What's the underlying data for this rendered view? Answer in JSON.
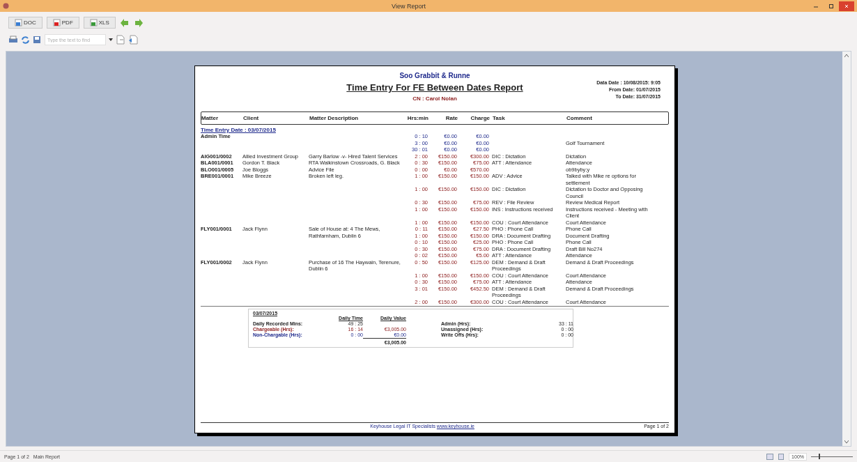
{
  "window": {
    "title": "View Report"
  },
  "export_buttons": [
    {
      "label": "DOC",
      "kind": "doc"
    },
    {
      "label": "PDF",
      "kind": "pdf"
    },
    {
      "label": "XLS",
      "kind": "xls"
    }
  ],
  "search": {
    "placeholder": "Type the text to find"
  },
  "report": {
    "firm": "Soo Grabbit & Runne",
    "title": "Time Entry For FE Between Dates Report",
    "fee_earner": "CN : Carol Nolan",
    "dates": [
      "Data Date : 10/08/2015: 9:05",
      "From Date: 01/07/2015",
      "To Date: 31/07/2015"
    ],
    "columns": [
      "Matter",
      "Client",
      "Matter Description",
      "Hrs:min",
      "Rate",
      "Charge",
      "Task",
      "Comment"
    ],
    "date_heading": "Time Entry Date : 03/07/2015",
    "matters": [
      {
        "matter": "Admin Time",
        "kind": "admin",
        "lines": [
          {
            "hrs": "0 : 10",
            "rate": "€0.00",
            "charge": "€0.00"
          },
          {
            "hrs": "3 : 00",
            "rate": "€0.00",
            "charge": "€0.00",
            "comment": "Golf Tournament"
          },
          {
            "hrs": "30 : 01",
            "rate": "€0.00",
            "charge": "€0.00"
          }
        ]
      },
      {
        "matter": "AIG001/0002",
        "client": "Allied Investment Group",
        "description": "Garry Barlow -v- Hired Talent Services",
        "kind": "chargeable",
        "lines": [
          {
            "hrs": "2 : 00",
            "rate": "€150.00",
            "charge": "€300.00",
            "task": "DIC :  Dictation",
            "comment": "Dictation"
          }
        ]
      },
      {
        "matter": "BLA001/0001",
        "client": "Gordon T. Black",
        "description": "RTA Walkinstown Crossroads, G. Black",
        "kind": "chargeable",
        "lines": [
          {
            "hrs": "0 : 30",
            "rate": "€150.00",
            "charge": "€75.00",
            "task": "ATT :  Attendance",
            "comment": "Attendance"
          }
        ]
      },
      {
        "matter": "BLO001/0005",
        "client": "Joe Bloggs",
        "description": "Advice File",
        "kind": "chargeable",
        "lines": [
          {
            "hrs": "0 : 00",
            "rate": "€0.00",
            "charge": "€570.00",
            "comment": "ob9byby;y"
          }
        ]
      },
      {
        "matter": "BRE001/0001",
        "client": "Mike Breeze",
        "description": "Broken left leg.",
        "kind": "chargeable",
        "lines": [
          {
            "hrs": "1 : 00",
            "rate": "€150.00",
            "charge": "€150.00",
            "task": "ADV :  Advice",
            "comment": "Talked with Mike re options for settlement"
          },
          {
            "hrs": "1 : 00",
            "rate": "€150.00",
            "charge": "€150.00",
            "task": "DIC :  Dictation",
            "comment": "Dictation to Doctor and Opposing Council"
          },
          {
            "hrs": "0 : 30",
            "rate": "€150.00",
            "charge": "€75.00",
            "task": "REV :  File Review",
            "comment": "Review Medical Report"
          },
          {
            "hrs": "1 : 00",
            "rate": "€150.00",
            "charge": "€150.00",
            "task": "INS :  Instructions received",
            "comment": "Instructions received - Meeting with Client"
          },
          {
            "hrs": "1 : 00",
            "rate": "€150.00",
            "charge": "€150.00",
            "task": "COU :  Court Attendance",
            "comment": "Court Attendance"
          }
        ]
      },
      {
        "matter": "FLY001/0001",
        "client": "Jack Flynn",
        "description": "Sale of House at:  4 The Mews, Rathfarnham, Dublin 6",
        "kind": "chargeable",
        "lines": [
          {
            "hrs": "0 : 11",
            "rate": "€150.00",
            "charge": "€27.50",
            "task": "PHO :  Phone Call",
            "comment": "Phone Call"
          },
          {
            "hrs": "1 : 00",
            "rate": "€150.00",
            "charge": "€150.00",
            "task": "DRA :  Document Drafting",
            "comment": "Document Drafting"
          },
          {
            "hrs": "0 : 10",
            "rate": "€150.00",
            "charge": "€25.00",
            "task": "PHO :  Phone Call",
            "comment": "Phone Call"
          },
          {
            "hrs": "0 : 30",
            "rate": "€150.00",
            "charge": "€75.00",
            "task": "DRA :  Document Drafting",
            "comment": "Draft Bill No274"
          },
          {
            "hrs": "0 : 02",
            "rate": "€150.00",
            "charge": "€5.00",
            "task": "ATT :  Attendance",
            "comment": "Attendance"
          }
        ]
      },
      {
        "matter": "FLY001/0002",
        "client": "Jack Flynn",
        "description": "Purchase of 16 The Haywain, Terenure, Dublin 6",
        "kind": "chargeable",
        "lines": [
          {
            "hrs": "0 : 50",
            "rate": "€150.00",
            "charge": "€125.00",
            "task": "DEM :  Demand & Draft Proceedings",
            "comment": "Demand & Draft Proceedings"
          },
          {
            "hrs": "1 : 00",
            "rate": "€150.00",
            "charge": "€150.00",
            "task": "COU :  Court Attendance",
            "comment": "Court Attendance"
          },
          {
            "hrs": "0 : 30",
            "rate": "€150.00",
            "charge": "€75.00",
            "task": "ATT :  Attendance",
            "comment": "Attendance"
          },
          {
            "hrs": "3 : 01",
            "rate": "€150.00",
            "charge": "€452.50",
            "task": "DEM :  Demand & Draft Proceedings",
            "comment": "Demand & Draft Proceedings"
          },
          {
            "hrs": "2 : 00",
            "rate": "€150.00",
            "charge": "€300.00",
            "task": "COU :  Court Attendance",
            "comment": "Court Attendance"
          }
        ]
      }
    ],
    "summary": {
      "date": "03/07/2015",
      "time_heading": "Daily Time",
      "value_heading": "Daily Value",
      "rows": [
        {
          "label": "Daily Recorded Mins:",
          "time": "49 : 25",
          "kind": "total"
        },
        {
          "label": "Chargeable (Hrs):",
          "time": "16 : 14",
          "value": "€3,005.00",
          "kind": "chargeable"
        },
        {
          "label": "Non-Chargable (Hrs):",
          "time": "0 : 00",
          "value": "€0.00",
          "kind": "admin"
        }
      ],
      "grand_total": "€3,005.00",
      "side": [
        {
          "label": "Admin (Hrs):",
          "value": "33 : 11"
        },
        {
          "label": "Unassigned  (Hrs):",
          "value": "0 : 00"
        },
        {
          "label": "Write Offs (Hrs):",
          "value": "0 : 00"
        }
      ]
    },
    "footer": {
      "text": "Keyhouse Legal IT Specialists",
      "link": "www.keyhouse.ie",
      "page": "Page 1 of 2"
    }
  },
  "status_bar": {
    "page": "Page 1 of 2",
    "report": "Main Report",
    "zoom": "100%",
    "zoom_slider": {
      "level": 0.2
    }
  }
}
